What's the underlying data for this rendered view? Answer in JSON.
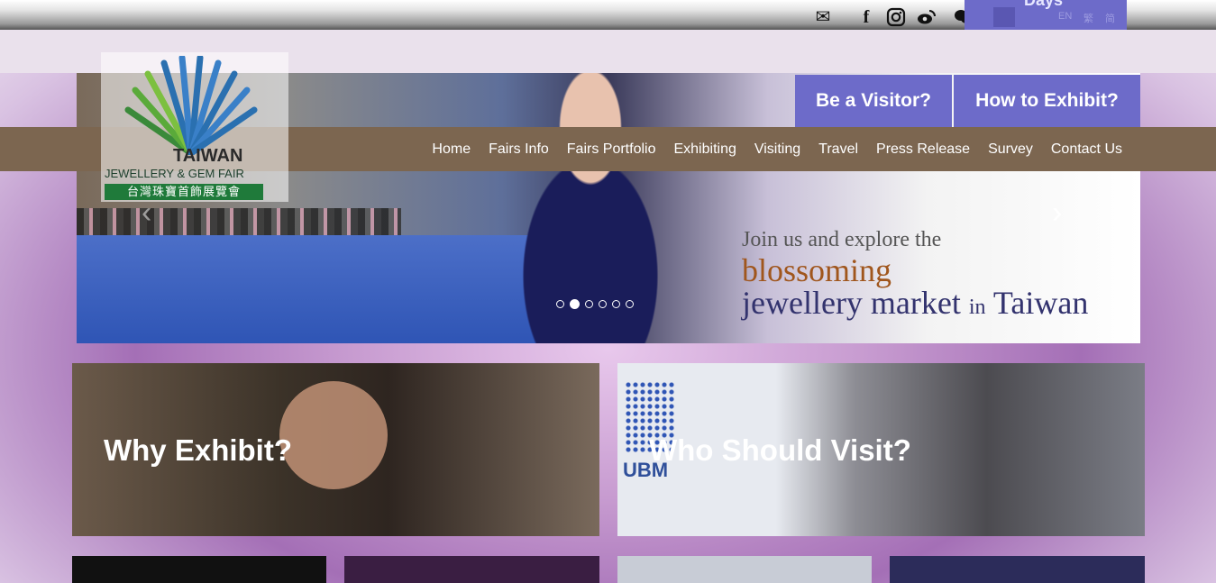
{
  "topbar": {
    "icons": [
      "mail-icon",
      "facebook-icon",
      "instagram-icon",
      "weibo-icon",
      "wechat-icon"
    ],
    "countdown_label": "Days",
    "languages": [
      "EN",
      "繁",
      "简"
    ]
  },
  "hero": {
    "logo": {
      "line1": "TAIWAN",
      "line2": "JEWELLERY & GEM FAIR",
      "line3": "台灣珠寶首飾展覽會"
    },
    "caption": {
      "line1": "Join us and explore the",
      "line2": "blossoming",
      "line3a": "jewellery market",
      "line3b": "in",
      "line3c": "Taiwan"
    },
    "slide_count": 6,
    "active_slide": 2
  },
  "cta": {
    "visitor": "Be a Visitor?",
    "exhibit": "How to Exhibit?"
  },
  "nav": {
    "items": [
      "Home",
      "Fairs Info",
      "Fairs Portfolio",
      "Exhibiting",
      "Visiting",
      "Travel",
      "Press Release",
      "Survey",
      "Contact Us"
    ]
  },
  "cards": {
    "why": "Why Exhibit?",
    "who": "Who Should Visit?",
    "ubm": "UBM"
  },
  "colors": {
    "accent": "#6d6bc9",
    "nav": "#7c6650",
    "logo_green": "#1f7a3a"
  }
}
